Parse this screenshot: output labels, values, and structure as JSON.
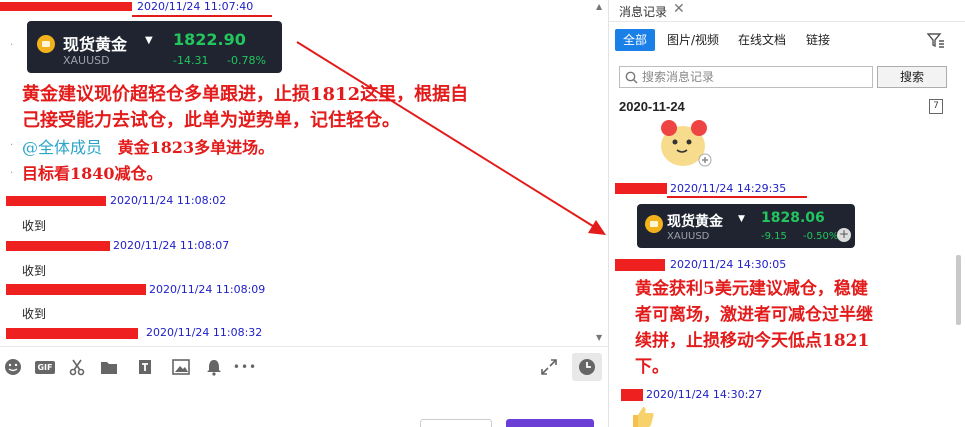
{
  "chat": {
    "msg1": {
      "time": "2020/11/24 11:07:40"
    },
    "card1": {
      "name": "现货黄金",
      "symbol": "XAUUSD",
      "price": "1822.90",
      "change": "-14.31",
      "change_pct": "-0.78%"
    },
    "advice": {
      "line1": "黄金建议现价超轻仓多单跟进，止损1812这里，根据自",
      "line2": "己接受能力去试仓，此单为逆势单，记住轻仓。",
      "mention": "@全体成员",
      "line3": "黄金1823多单进场。",
      "line4": "目标看1840减仓。"
    },
    "replies": [
      {
        "time": "2020/11/24 11:08:02",
        "text": "收到"
      },
      {
        "time": "2020/11/24 11:08:07",
        "text": "收到"
      },
      {
        "time": "2020/11/24 11:08:09",
        "text": "收到"
      },
      {
        "time": "2020/11/24 11:08:32",
        "text": ""
      }
    ]
  },
  "toolbar": {
    "icons": [
      "emoji-icon",
      "gif-icon",
      "scissors-icon",
      "folder-icon",
      "doc-icon",
      "image-icon",
      "bell-icon",
      "more-icon"
    ],
    "gif_label": "GIF",
    "more_label": "•••"
  },
  "history": {
    "title": "消息记录",
    "close": "✕",
    "tabs": [
      "全部",
      "图片/视频",
      "在线文档",
      "链接"
    ],
    "search_placeholder": "搜索消息记录",
    "search_button": "搜索",
    "date": "2020-11-24",
    "calendar_label": "7",
    "msg1": {
      "time": "2020/11/24 14:29:35"
    },
    "card2": {
      "name": "现货黄金",
      "symbol": "XAUUSD",
      "price": "1828.06",
      "change": "-9.15",
      "change_pct": "-0.50%"
    },
    "msg2": {
      "time": "2020/11/24 14:30:05"
    },
    "profit": {
      "line1": "黄金获利5美元建议减仓，稳健",
      "line2": "者可离场，激进者可减仓过半继",
      "line3": "续拼，止损移动今天低点1821",
      "line4": "下。"
    },
    "msg3": {
      "time": "2020/11/24 14:30:27"
    }
  },
  "colors": {
    "accent": "#1a7fe6",
    "redact": "#ee2020",
    "red_text": "#e31b1b",
    "timestamp": "#1d1dc8",
    "price_up": "#22c55e",
    "card_bg": "#1f2430"
  }
}
